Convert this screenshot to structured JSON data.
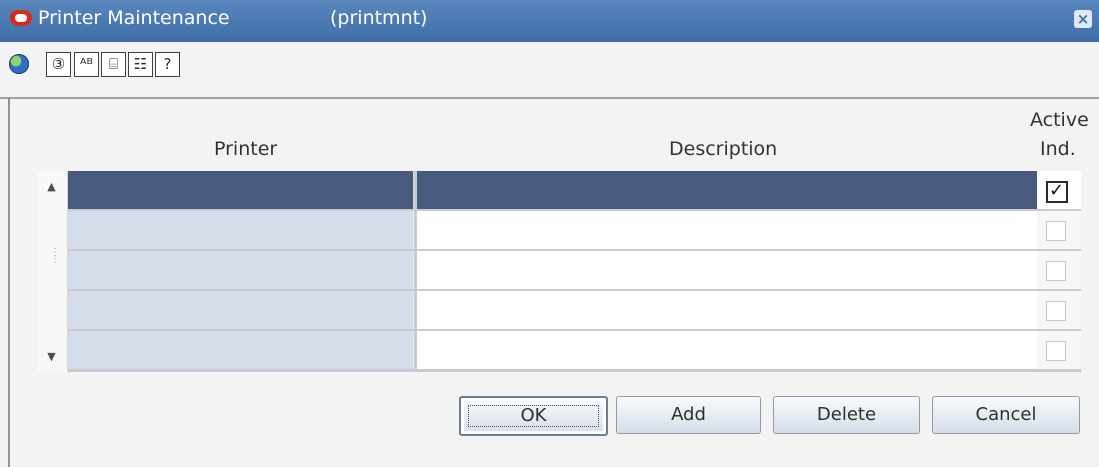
{
  "window": {
    "title": "Printer Maintenance",
    "code": "(printmnt)",
    "close_icon": "×",
    "icons": [
      "oracle-logo-icon",
      "globe-icon",
      "ledger-icon",
      "calculator-icon",
      "document-icon",
      "notes-icon",
      "help-icon"
    ]
  },
  "toolbar": {
    "tool1": "③",
    "tool2": "ᴬᴮ",
    "tool3": "⌸",
    "tool4": "☷",
    "tool5": "?"
  },
  "table": {
    "columns": {
      "printer": "Printer",
      "description": "Description",
      "active_line1": "Active",
      "active_line2": "Ind."
    },
    "rows": [
      {
        "selected": true,
        "active": true
      },
      {
        "selected": false,
        "active": false
      },
      {
        "selected": false,
        "active": false
      },
      {
        "selected": false,
        "active": false
      },
      {
        "selected": false,
        "active": false
      }
    ],
    "scroll_up": "▲",
    "scroll_down": "▼"
  },
  "buttons": {
    "ok": "OK",
    "add": "Add",
    "delete": "Delete",
    "cancel": "Cancel"
  }
}
